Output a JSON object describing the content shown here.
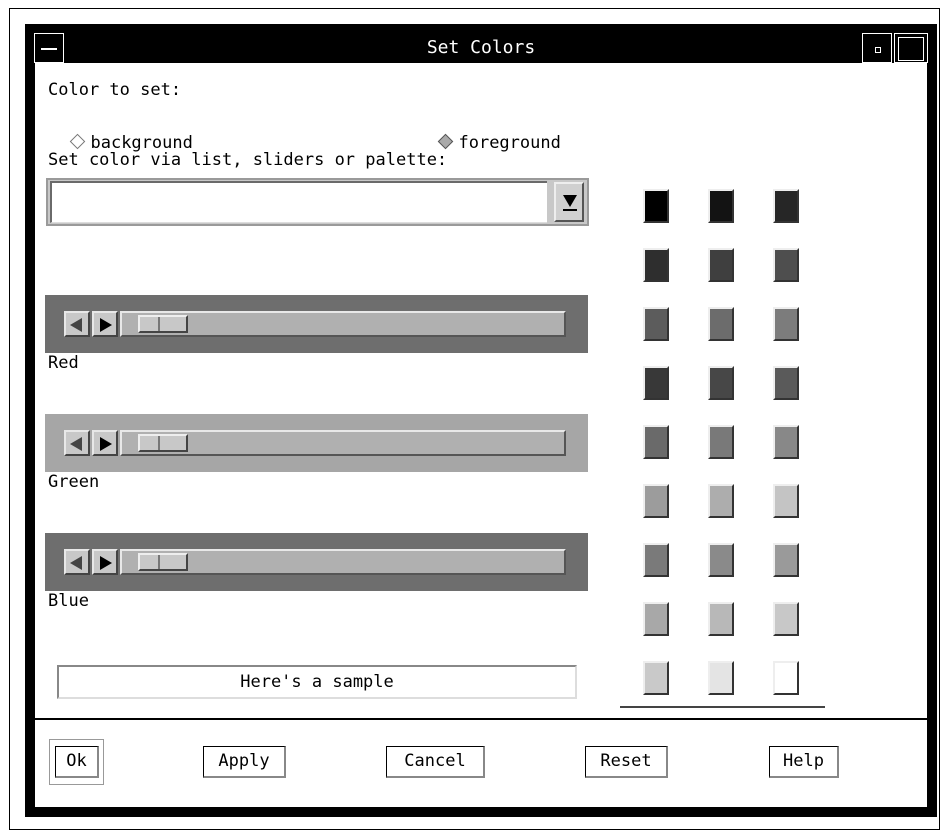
{
  "window": {
    "title": "Set Colors"
  },
  "color_to_set": {
    "label": "Color to set:",
    "options": [
      {
        "label": "background",
        "selected": false
      },
      {
        "label": "foreground",
        "selected": true
      }
    ]
  },
  "via_label": "Set color via list, sliders or palette:",
  "color_list": {
    "value": ""
  },
  "sliders": [
    {
      "label": "Red",
      "panel_color": "#6e6e6e",
      "value_fraction": 0.04
    },
    {
      "label": "Green",
      "panel_color": "#a6a6a6",
      "value_fraction": 0.04
    },
    {
      "label": "Blue",
      "panel_color": "#6e6e6e",
      "value_fraction": 0.04
    }
  ],
  "sample_text": "Here's a sample",
  "palette": [
    [
      "#000000",
      "#131313",
      "#262626"
    ],
    [
      "#2e2e2e",
      "#3f3f3f",
      "#4e4e4e"
    ],
    [
      "#5c5c5c",
      "#6c6c6c",
      "#7c7c7c"
    ],
    [
      "#383838",
      "#474747",
      "#5a5a5a"
    ],
    [
      "#6a6a6a",
      "#797979",
      "#888888"
    ],
    [
      "#9c9c9c",
      "#adadad",
      "#c4c4c4"
    ],
    [
      "#7a7a7a",
      "#8a8a8a",
      "#9a9a9a"
    ],
    [
      "#a8a8a8",
      "#b8b8b8",
      "#c8c8c8"
    ],
    [
      "#c9c9c9",
      "#e4e4e4",
      "#ffffff"
    ]
  ],
  "buttons": {
    "ok": "Ok",
    "apply": "Apply",
    "cancel": "Cancel",
    "reset": "Reset",
    "help": "Help"
  }
}
